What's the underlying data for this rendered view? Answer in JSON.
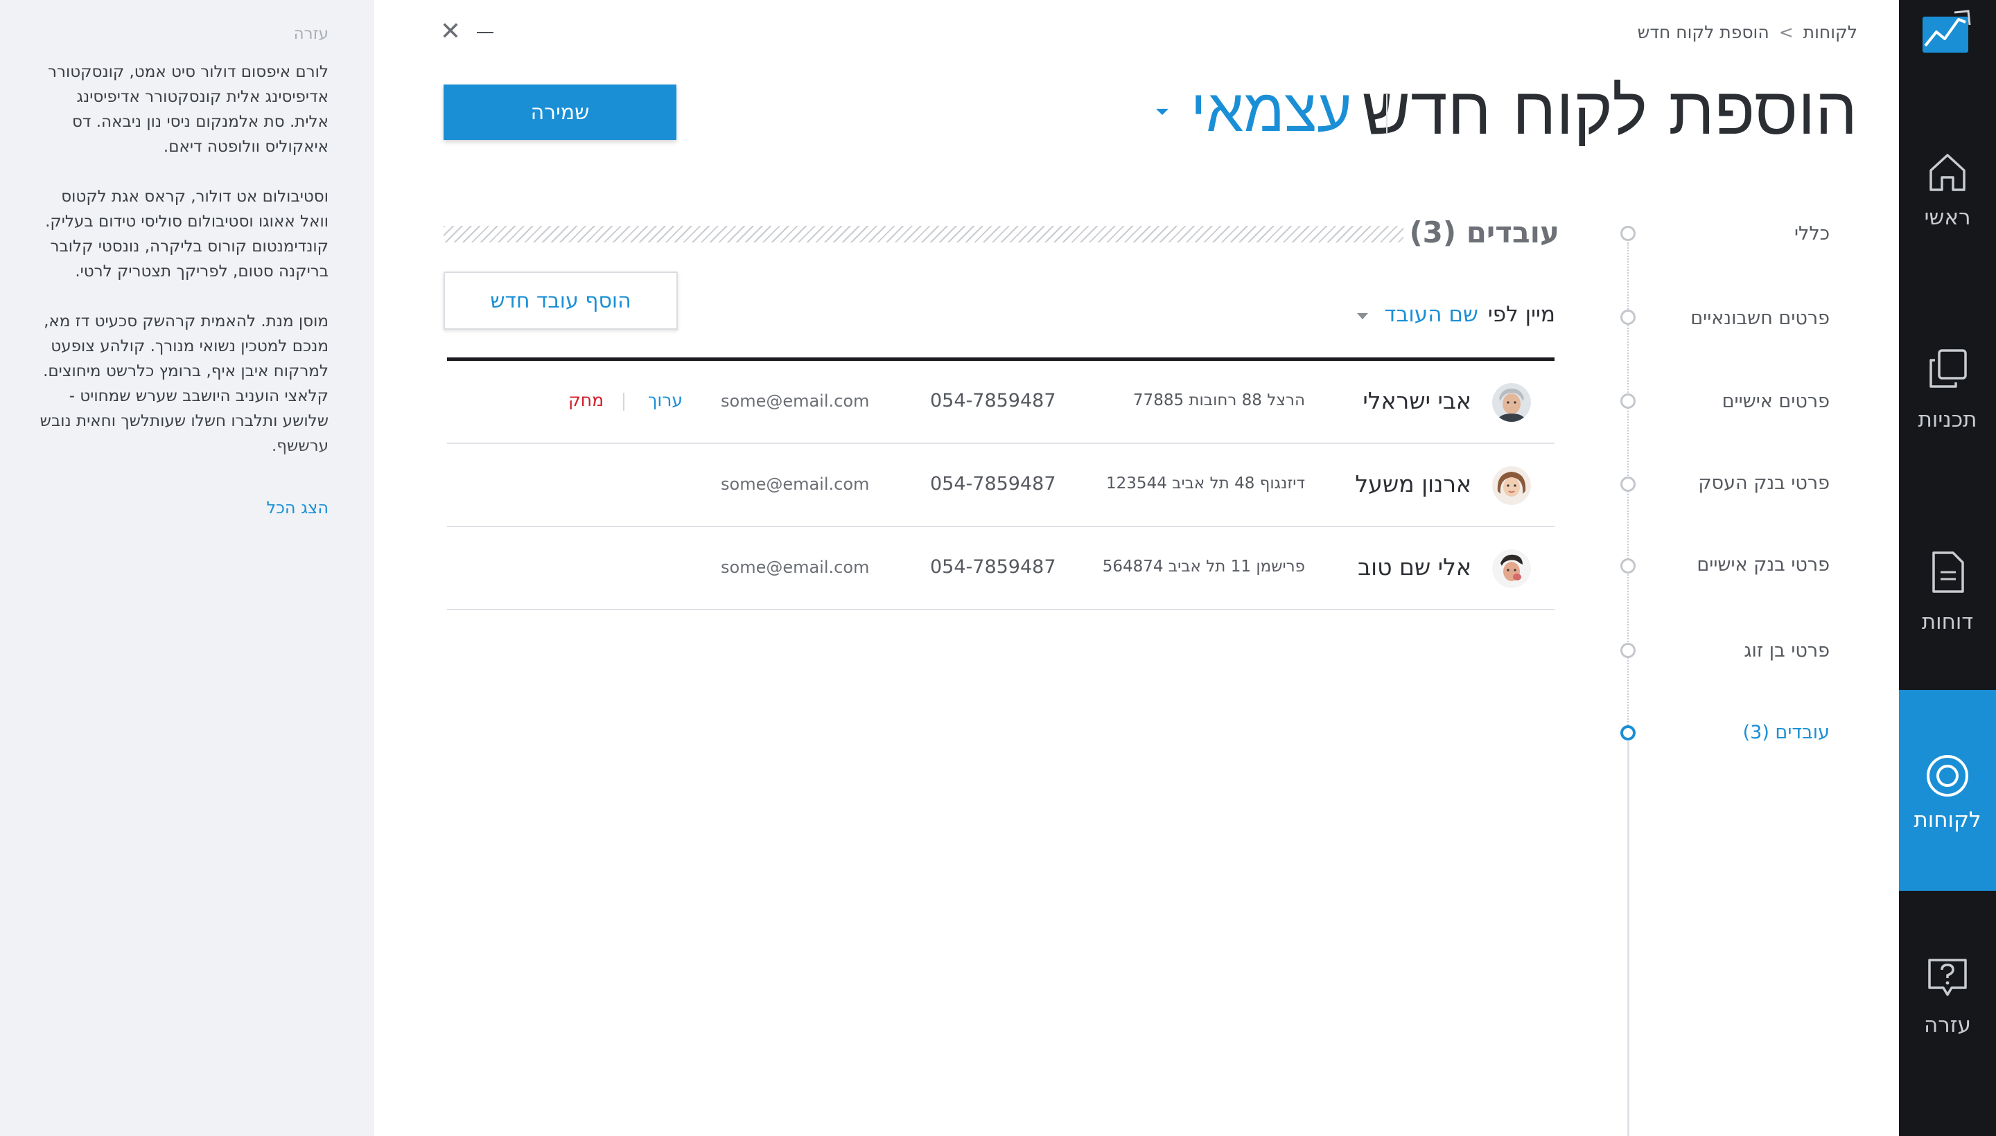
{
  "window": {
    "close_glyph": "✕",
    "minimize_label": "minimize"
  },
  "breadcrumb": {
    "root": "לקוחות",
    "separator": ">",
    "current": "הוספת לקוח חדש"
  },
  "header": {
    "title": "הוספת לקוח חדש",
    "client_type": "עצמאי",
    "save_label": "שמירה"
  },
  "steps": [
    {
      "label": "כללי",
      "active": false
    },
    {
      "label": "פרטים חשבונאיים",
      "active": false
    },
    {
      "label": "פרטים אישיים",
      "active": false
    },
    {
      "label": "פרטי בנק העסק",
      "active": false
    },
    {
      "label": "פרטי בנק אישיים",
      "active": false
    },
    {
      "label": "פרטי בן זוג",
      "active": false
    },
    {
      "label": "עובדים (3)",
      "active": true
    }
  ],
  "section": {
    "title": "עובדים (3)",
    "add_button": "הוסף עובד חדש",
    "sort_label": "מיין לפי",
    "sort_value": "שם העובד"
  },
  "employees": [
    {
      "name": "אבי ישראלי",
      "address": "הרצל 88 רחובות 77885",
      "phone": "054-7859487",
      "email": "some@email.com",
      "edit": "ערוך",
      "delete": "מחק"
    },
    {
      "name": "ארנון משעל",
      "address": "דיזנגוף 48 תל אביב 123544",
      "phone": "054-7859487",
      "email": "some@email.com"
    },
    {
      "name": "אלי שם טוב",
      "address": "פרישמן 11 תל אביב 564874",
      "phone": "054-7859487",
      "email": "some@email.com"
    }
  ],
  "help": {
    "title": "עזרה",
    "paragraphs": [
      "לורם איפסום דולור סיט אמט, קונסקטורר אדיפיסינג אלית קונסקטורר אדיפיסינג אלית. סת אלמנקום ניסי נון ניבאה. דס איאקוליס וולופטה דיאם.",
      "וסטיבולום אט דולור, קראס אגת לקטוס וואל אאוגו וסטיבולום סוליסי טידום בעליק. קונדימנטום קורוס בליקרה, נונסטי קלובר בריקנה סטום, לפריקך תצטריק לרטי.",
      "מוסן מנת. להאמית קרהשק סכעיט דז מא, מנכם למטכין נשואי מנורך. קולהע צופעט למרקוח איבן איף, ברומץ כלרשט מיחוצים. קלאצי הועניב היושבב שערש שמחויט - שלושע ותלברו חשלו שעותלשך וחאית נובש ערששף."
    ],
    "show_all": "הצג הכל"
  },
  "sidebar": {
    "items": [
      {
        "label": "ראשי",
        "icon": "home-icon",
        "active": false
      },
      {
        "label": "תכניות",
        "icon": "copy-icon",
        "active": false
      },
      {
        "label": "דוחות",
        "icon": "document-icon",
        "active": false
      },
      {
        "label": "לקוחות",
        "icon": "target-icon",
        "active": true
      },
      {
        "label": "עזרה",
        "icon": "help-bubble-icon",
        "active": false
      }
    ]
  },
  "colors": {
    "accent": "#1a8fd6",
    "sidebar_bg": "#15171a",
    "help_bg": "#f0f2f5",
    "danger": "#d0202a"
  }
}
